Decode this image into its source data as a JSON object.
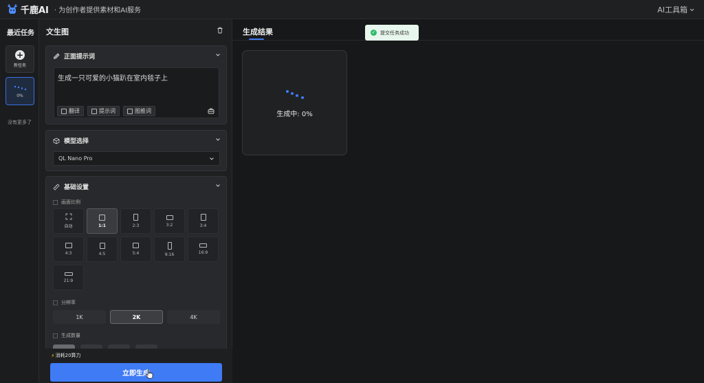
{
  "app": {
    "brand": "千鹿AI",
    "slogan": "· 为创作者提供素材和AI服务",
    "tools_menu": "AI工具箱"
  },
  "sidebar": {
    "title": "最近任务",
    "new_task_label": "新任务",
    "current_task_progress": "0%",
    "empty_note": "没有更多了"
  },
  "panel": {
    "title": "文生图",
    "prompt_section": {
      "title": "正面提示词",
      "value": "生成一只可爱的小猫趴在室内毯子上",
      "actions": [
        "翻译",
        "提示词",
        "图推词"
      ]
    },
    "model_section": {
      "title": "模型选择",
      "selected": "QL Nano Pro"
    },
    "basic_section": {
      "title": "基础设置",
      "aspect_label": "画面比例",
      "aspect_ratios": [
        "自动",
        "1:1",
        "2:3",
        "3:2",
        "3:4",
        "4:3",
        "4:5",
        "5:4",
        "9:16",
        "16:9",
        "21:9"
      ],
      "aspect_selected": "1:1",
      "resolution_label": "分辨率",
      "resolutions": [
        "1K",
        "2K",
        "4K"
      ],
      "resolution_selected": "2K",
      "count_label": "生成数量"
    },
    "cost_text": "消耗20算力",
    "generate_button": "立即生成"
  },
  "results": {
    "tab": "生成结果",
    "toast": "提交任务成功",
    "status": "生成中: 0%"
  },
  "colors": {
    "accent": "#3f7bf5",
    "success": "#2dbb6a",
    "bolt": "#f5c518"
  }
}
